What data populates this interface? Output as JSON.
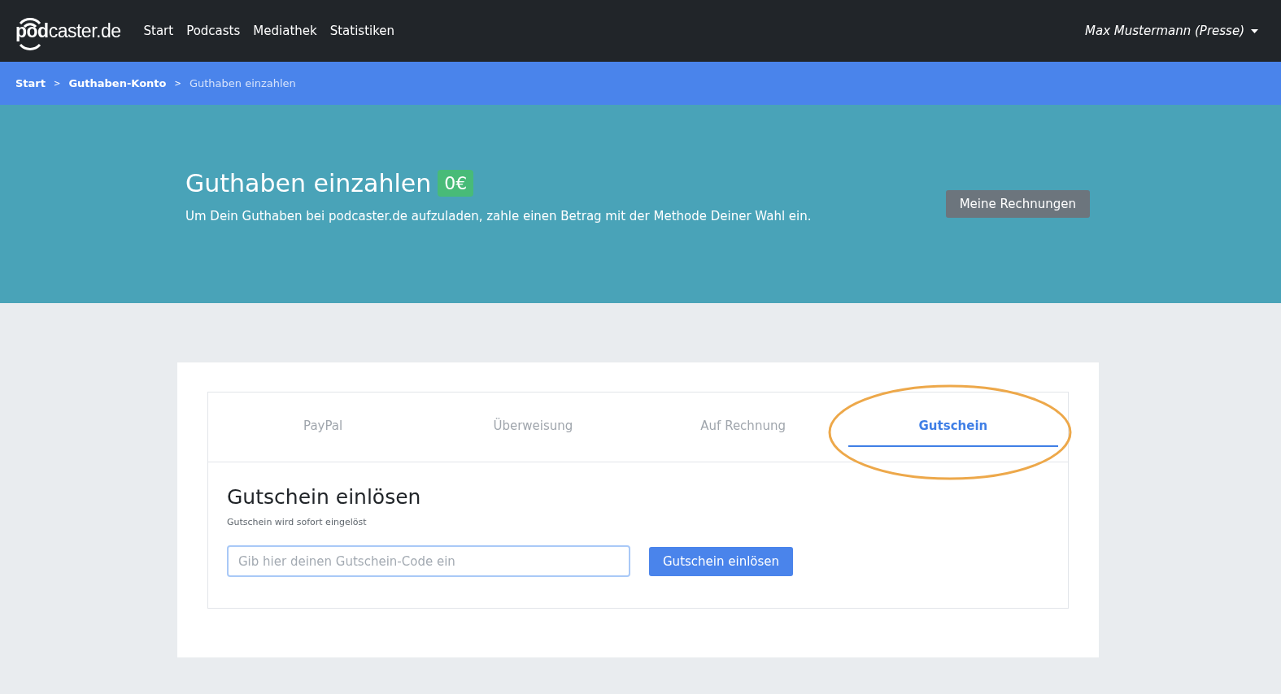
{
  "navbar": {
    "logo": "**pod**caster.de",
    "links": [
      "Start",
      "Podcasts",
      "Mediathek",
      "Statistiken"
    ],
    "user": "Max Mustermann (Presse)"
  },
  "breadcrumb": [
    {
      "label": "Start",
      "current": false
    },
    {
      "label": "Guthaben-Konto",
      "current": false
    },
    {
      "label": "Guthaben einzahlen",
      "current": true
    }
  ],
  "breadcrumb_separator": ">",
  "hero": {
    "title": "Guthaben einzahlen",
    "balance": "0€",
    "description": "Um Dein Guthaben bei podcaster.de aufzuladen, zahle einen Betrag mit der Methode Deiner Wahl ein.",
    "button": "Meine Rechnungen"
  },
  "tabs": [
    {
      "label": "PayPal",
      "selected": false,
      "circled": false
    },
    {
      "label": "Überweisung",
      "selected": false,
      "circled": false
    },
    {
      "label": "Auf Rechnung",
      "selected": false,
      "circled": false
    },
    {
      "label": "Gutschein",
      "selected": true,
      "circled": true
    }
  ],
  "panel": {
    "title": "Gutschein einlösen",
    "subtitle": "Gutschein wird sofort eingelöst",
    "input": {
      "placeholder": "Gib hier deinen Gutschein-Code ein",
      "focused": true
    },
    "button": "Gutschein einlösen"
  }
}
